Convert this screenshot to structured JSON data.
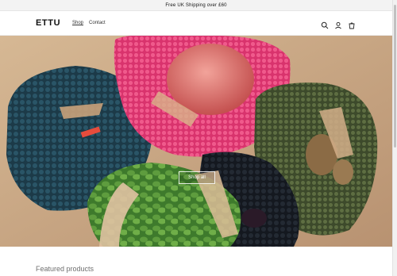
{
  "announcement": {
    "text": "Free UK Shipping over £60"
  },
  "header": {
    "logo": "ETTU",
    "nav": [
      {
        "label": "Shop",
        "active": true
      },
      {
        "label": "Contact",
        "active": false
      }
    ],
    "icons": [
      "search-icon",
      "account-icon",
      "cart-icon"
    ]
  },
  "hero": {
    "image": "bags-of-produce-photo",
    "button_label": "Shop all"
  },
  "featured": {
    "title": "Featured products"
  },
  "colors": {
    "announcement_bg": "#f3f3f3",
    "pink_bag": "#e83a78",
    "teal_bag": "#1f3f4d",
    "green_bag": "#4d5c37"
  }
}
